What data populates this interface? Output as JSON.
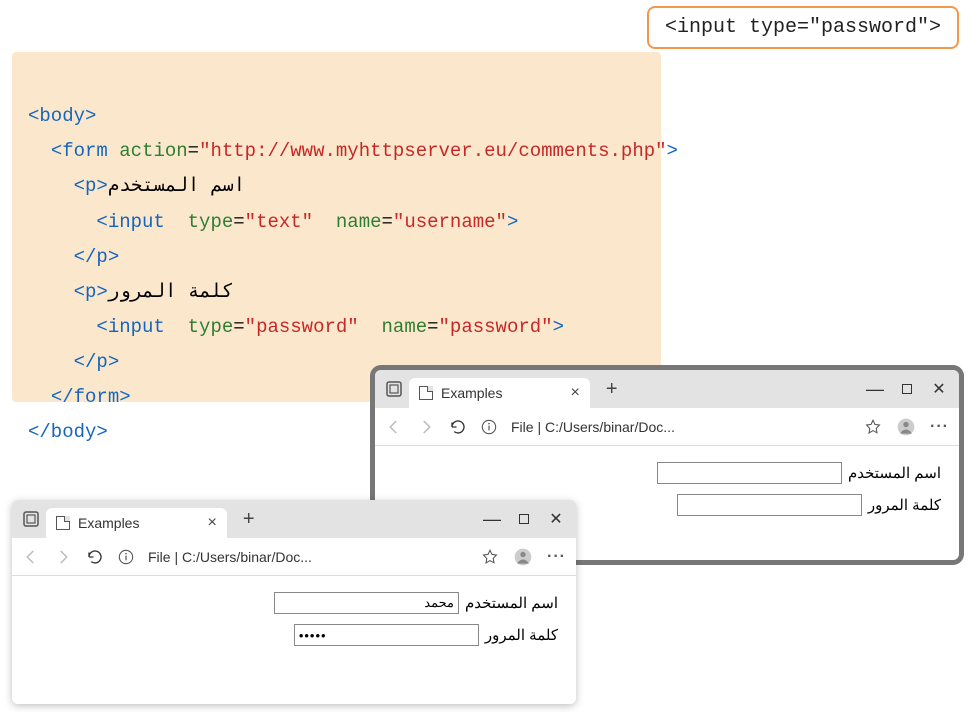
{
  "callout": {
    "text": "<input type=\"password\">"
  },
  "code": {
    "line1_open_body": "<body>",
    "line2_open_form": "<form",
    "line2_attr_action": "action",
    "line2_val_action": "\"http://www.myhttpserver.eu/comments.php\"",
    "line2_close": ">",
    "line3_open_p": "<p>",
    "line3_text": "اسم المستخدم",
    "line4_open_input": "<input",
    "line4_attr_type": "type",
    "line4_val_type": "\"text\"",
    "line4_attr_name": "name",
    "line4_val_name": "\"username\"",
    "line4_close": ">",
    "line5_close_p": "</p>",
    "line6_open_p": "<p>",
    "line6_text": "كلمة المرور",
    "line7_open_input": "<input",
    "line7_attr_type": "type",
    "line7_val_type": "\"password\"",
    "line7_attr_name": "name",
    "line7_val_name": "\"password\"",
    "line7_close": ">",
    "line8_close_p": "</p>",
    "line9_close_form": "</form>",
    "line10_close_body": "</body>"
  },
  "browser_shared": {
    "tab_title": "Examples",
    "addr_prefix": "File  |  C:/Users/binar/Doc...",
    "label_username": "اسم المستخدم",
    "label_password": "كلمة المرور"
  },
  "browser1_filled": {
    "username_value": "محمد",
    "password_value": "•••••"
  },
  "browser2_empty": {
    "username_value": "",
    "password_value": ""
  }
}
